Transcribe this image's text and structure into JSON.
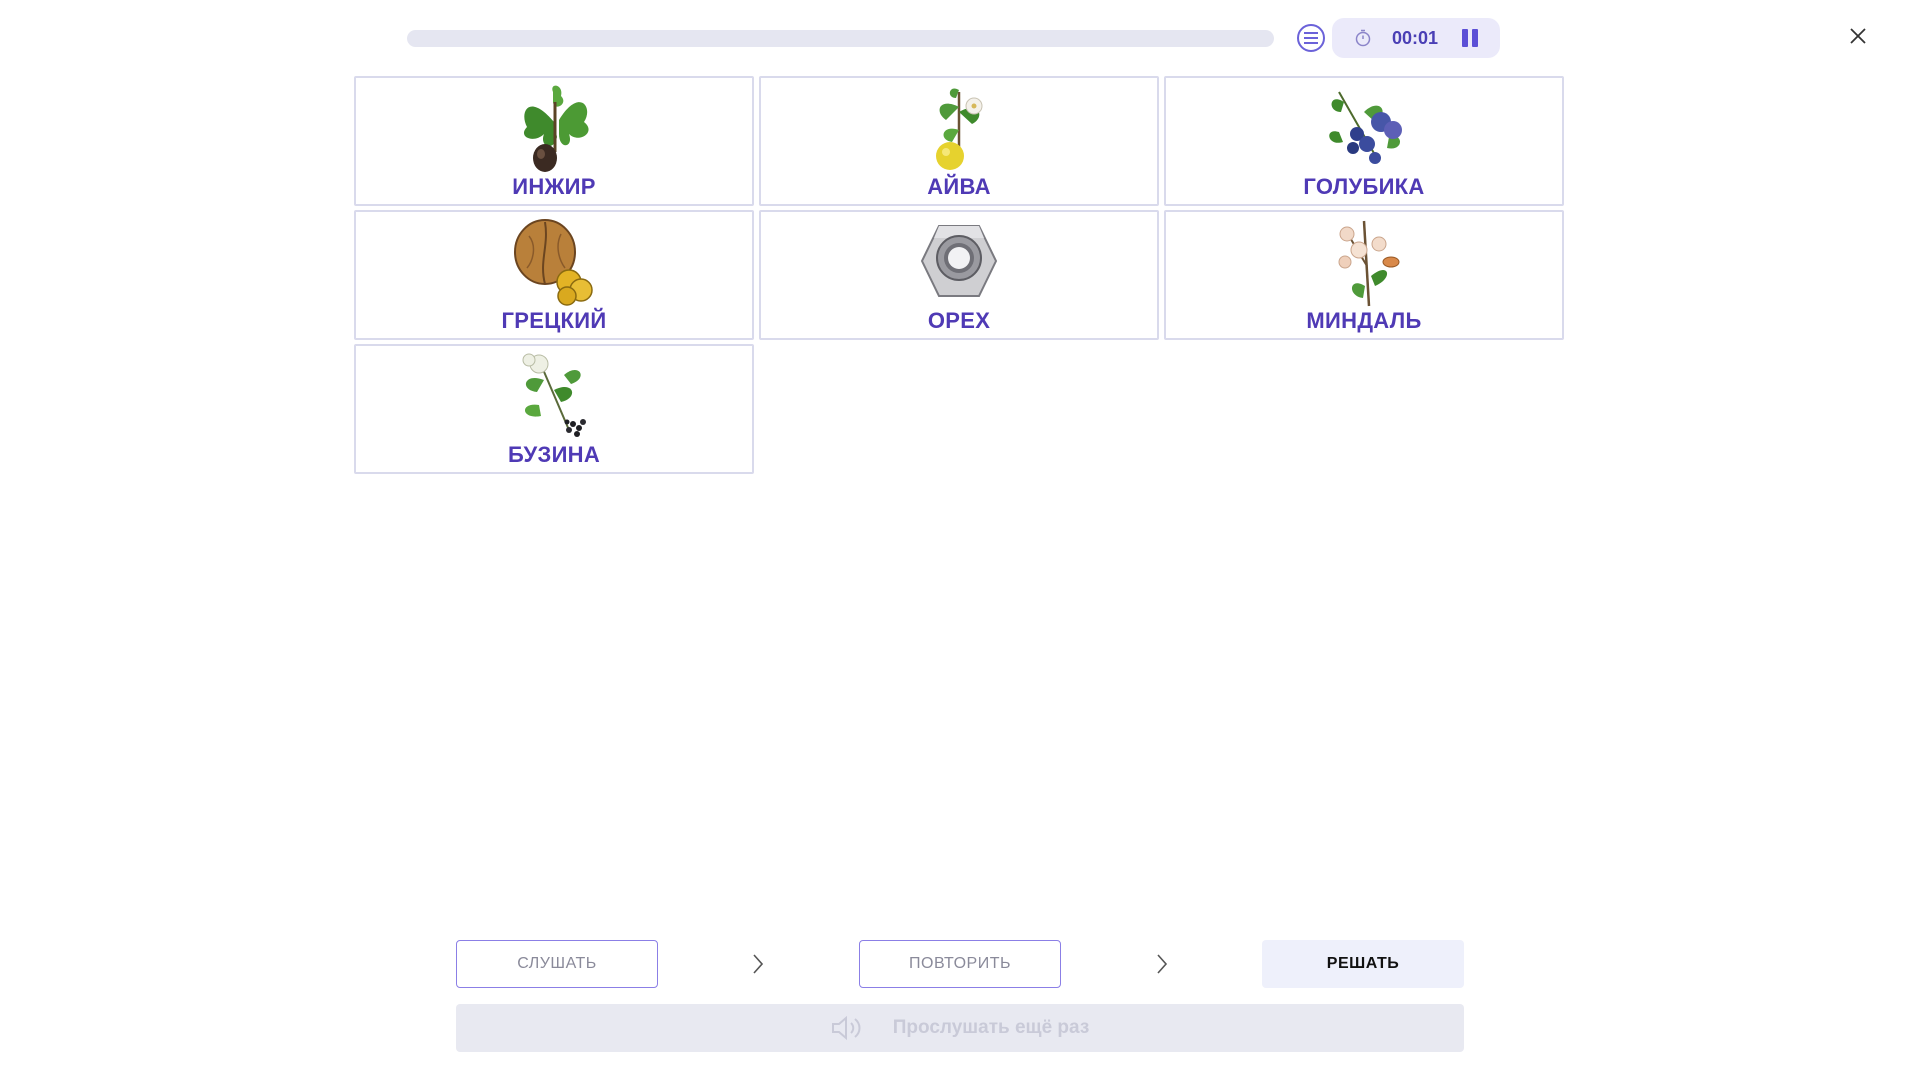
{
  "header": {
    "progress_fraction": 0,
    "timer": "00:01"
  },
  "cards": [
    {
      "label": "ИНЖИР",
      "icon": "fig-plant-image"
    },
    {
      "label": "АЙВА",
      "icon": "quince-plant-image"
    },
    {
      "label": "ГОЛУБИКА",
      "icon": "blueberry-plant-image"
    },
    {
      "label": "ГРЕЦКИЙ",
      "icon": "walnut-image"
    },
    {
      "label": "ОРЕХ",
      "icon": "hex-nut-image"
    },
    {
      "label": "МИНДАЛЬ",
      "icon": "almond-blossom-image"
    },
    {
      "label": "БУЗИНА",
      "icon": "elderberry-plant-image"
    }
  ],
  "controls": {
    "listen_label": "СЛУШАТЬ",
    "repeat_label": "ПОВТОРИТЬ",
    "solve_label": "РЕШАТЬ",
    "listen_again_label": "Прослушать ещё раз"
  },
  "colors": {
    "accent": "#5b4fd6",
    "label": "#4f3ab5",
    "card_border": "#d9daec"
  }
}
